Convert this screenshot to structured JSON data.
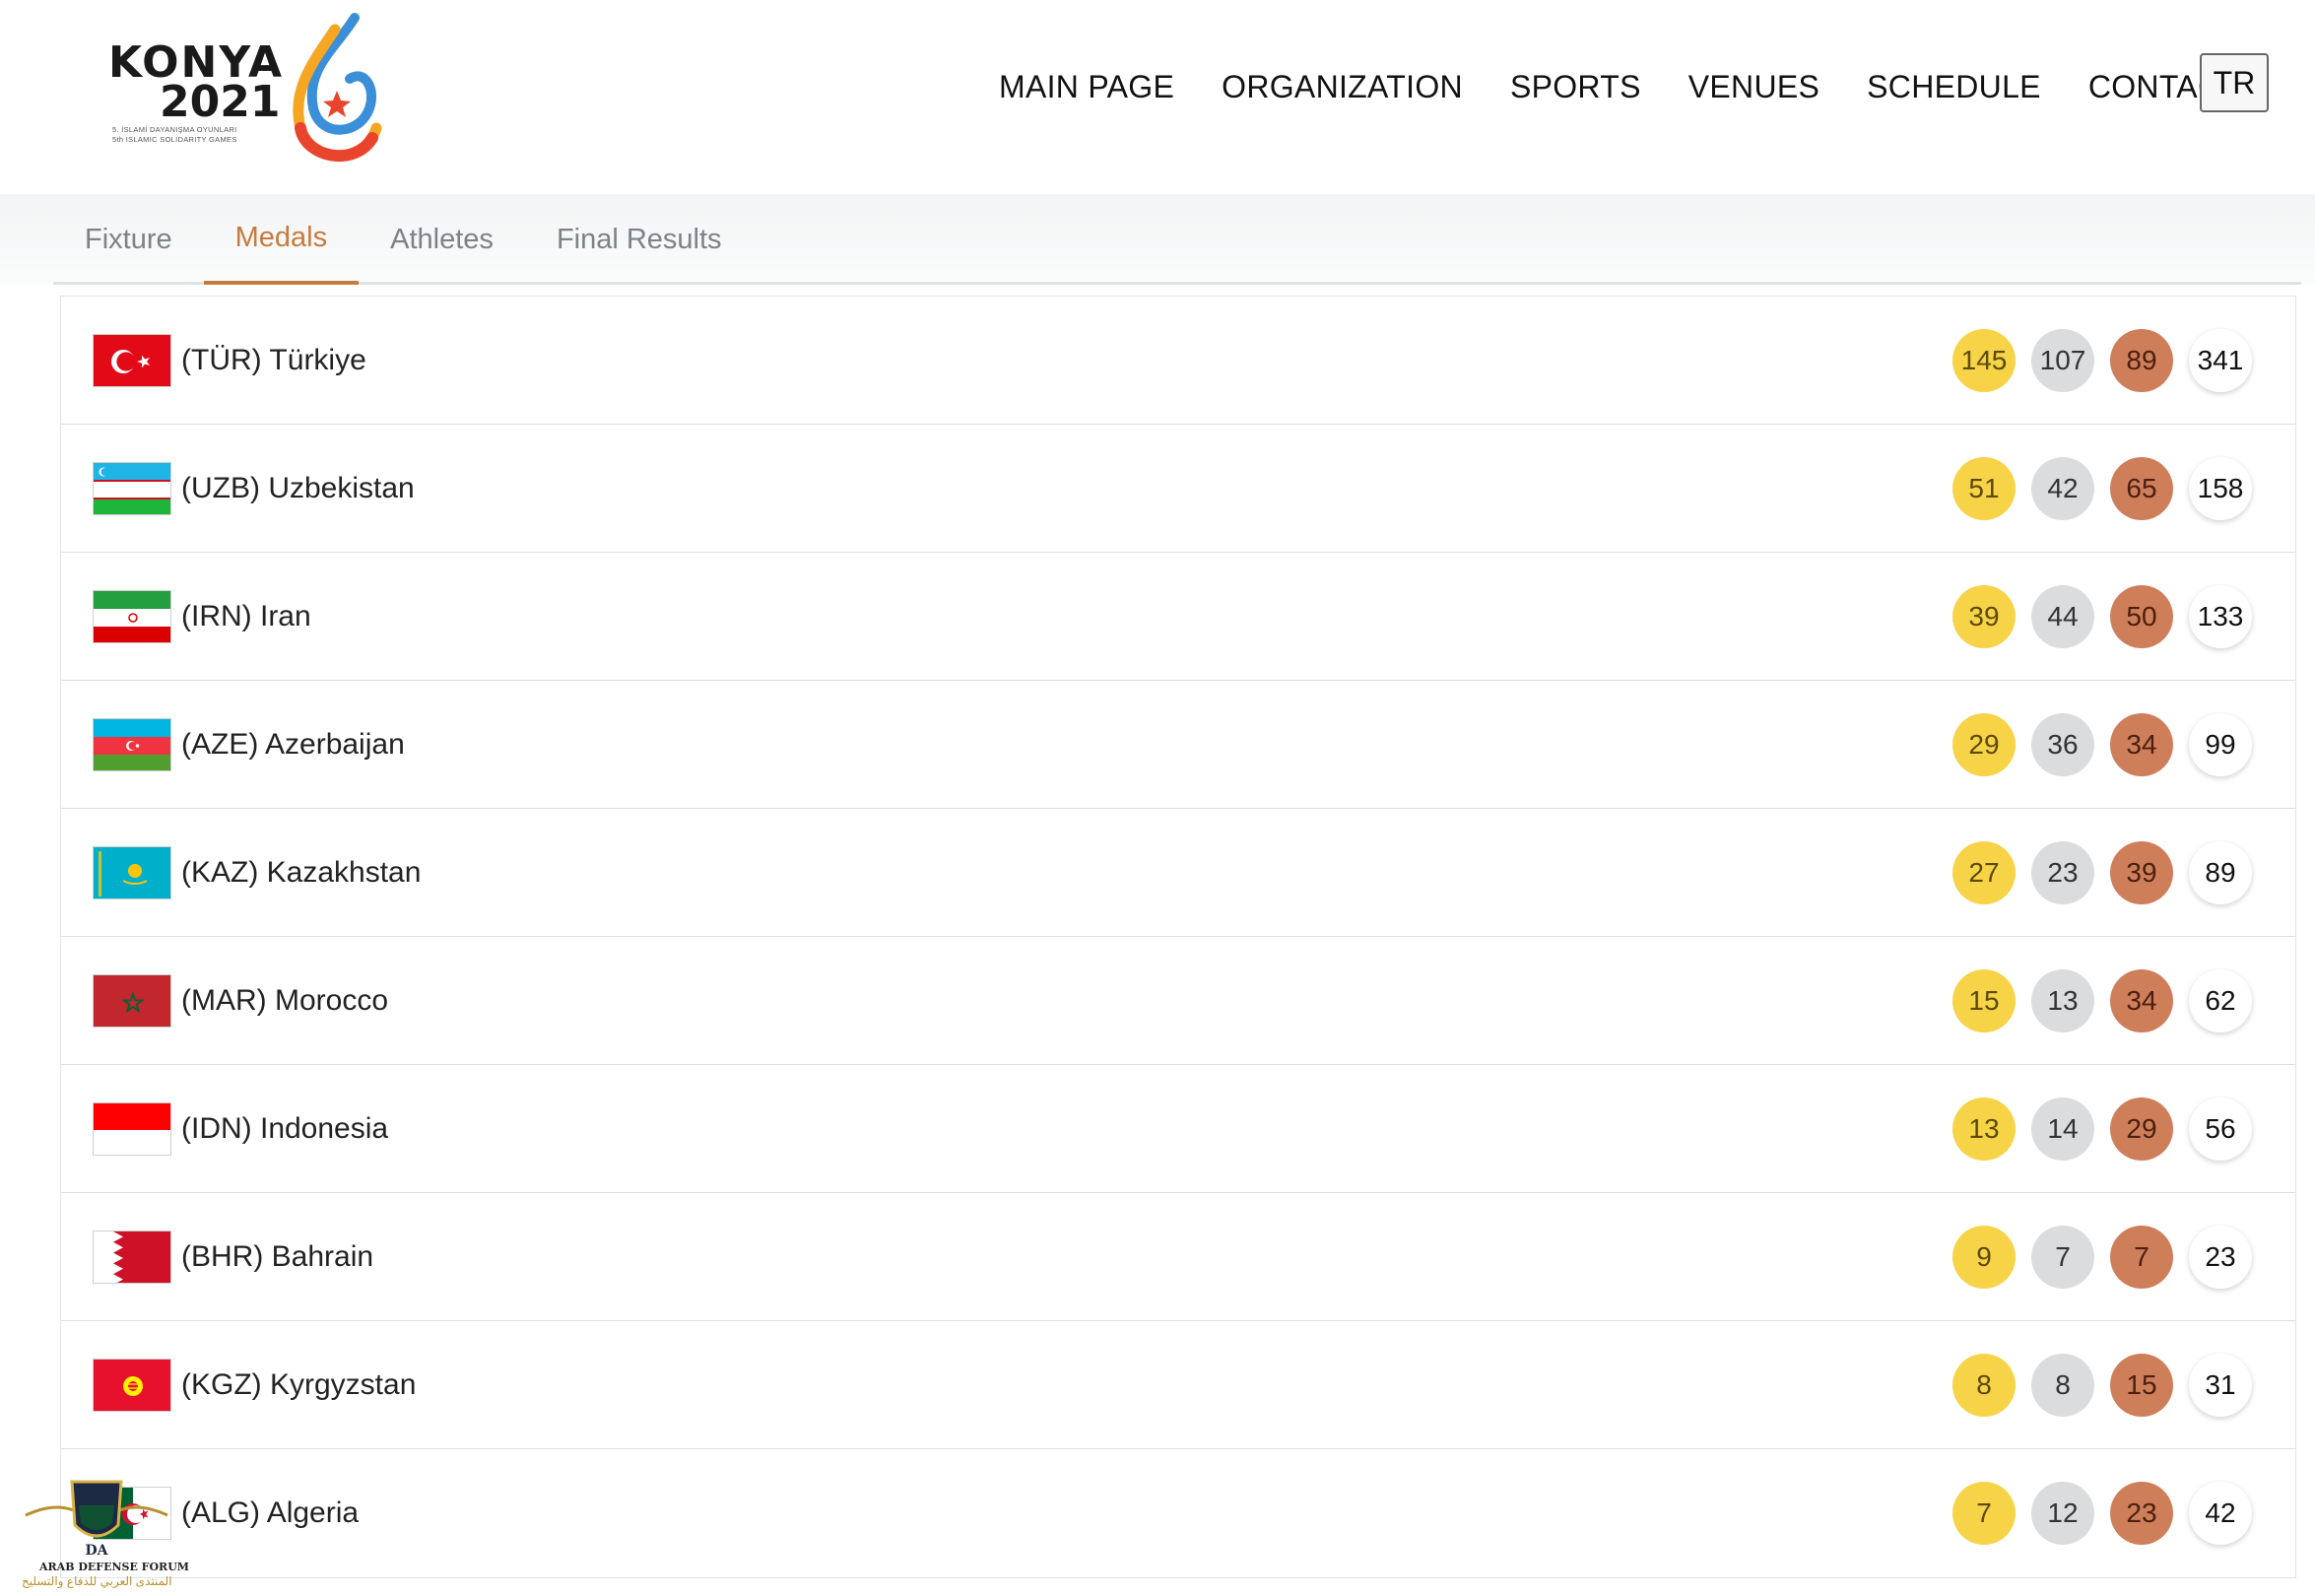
{
  "logo": {
    "word1": "KONYA",
    "word2": "2021",
    "sub1": "5. İSLAMİ DAYANIŞMA OYUNLARI",
    "sub2": "5th ISLAMIC SOLIDARITY GAMES"
  },
  "nav": {
    "items": [
      "MAIN PAGE",
      "ORGANIZATION",
      "SPORTS",
      "VENUES",
      "SCHEDULE",
      "CONTACT"
    ],
    "lang": "TR"
  },
  "tabs": {
    "items": [
      "Fixture",
      "Medals",
      "Athletes",
      "Final Results"
    ],
    "active": "Medals"
  },
  "medal_table": [
    {
      "label": "(TÜR) Türkiye",
      "gold": "145",
      "silver": "107",
      "bronze": "89",
      "total": "341"
    },
    {
      "label": "(UZB) Uzbekistan",
      "gold": "51",
      "silver": "42",
      "bronze": "65",
      "total": "158"
    },
    {
      "label": "(IRN) Iran",
      "gold": "39",
      "silver": "44",
      "bronze": "50",
      "total": "133"
    },
    {
      "label": "(AZE) Azerbaijan",
      "gold": "29",
      "silver": "36",
      "bronze": "34",
      "total": "99"
    },
    {
      "label": "(KAZ) Kazakhstan",
      "gold": "27",
      "silver": "23",
      "bronze": "39",
      "total": "89"
    },
    {
      "label": "(MAR) Morocco",
      "gold": "15",
      "silver": "13",
      "bronze": "34",
      "total": "62"
    },
    {
      "label": "(IDN) Indonesia",
      "gold": "13",
      "silver": "14",
      "bronze": "29",
      "total": "56"
    },
    {
      "label": "(BHR) Bahrain",
      "gold": "9",
      "silver": "7",
      "bronze": "7",
      "total": "23"
    },
    {
      "label": "(KGZ) Kyrgyzstan",
      "gold": "8",
      "silver": "8",
      "bronze": "15",
      "total": "31"
    },
    {
      "label": "(ALG) Algeria",
      "gold": "7",
      "silver": "12",
      "bronze": "23",
      "total": "42"
    }
  ],
  "colors": {
    "accent": "#c77a3d",
    "gold": "#f7d348",
    "silver": "#dadcdd",
    "bronze": "#cf7e5a"
  },
  "watermark": {
    "line1": "ARAB DEFENSE FORUM",
    "line2": "المنتدى العربي للدفاع والتسليح"
  }
}
